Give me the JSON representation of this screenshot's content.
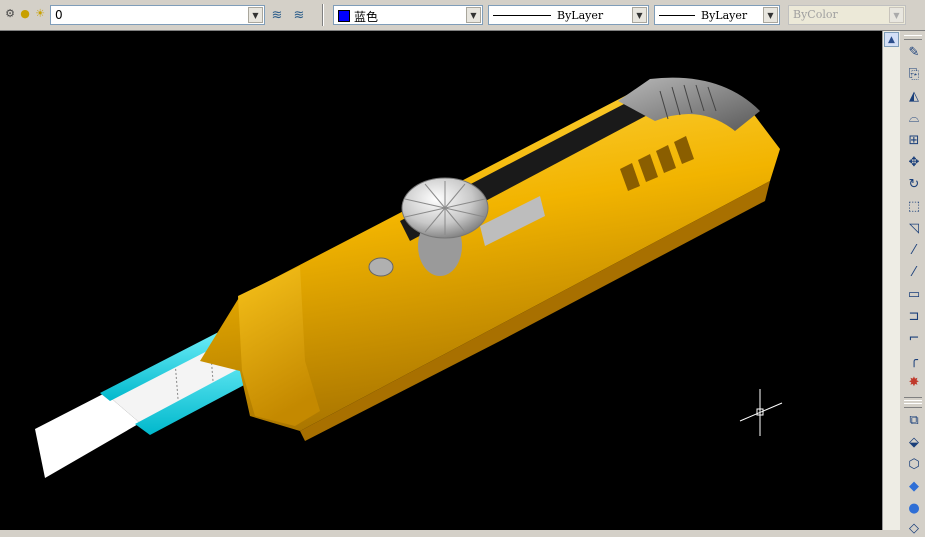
{
  "toolbar": {
    "layer_icons": [
      "layer-state-icon",
      "lightbulb-icon",
      "sun-icon",
      "lock-icon",
      "color-square-icon"
    ],
    "layer_name": "0",
    "color_value": "蓝色",
    "linetype_value": "ByLayer",
    "lineweight_value": "ByLayer",
    "plotstyle_value": "ByColor",
    "colors": {
      "current_color": "#0000ff"
    }
  },
  "drawing": {
    "background": "#000000",
    "body_color": "#f2b400",
    "blade_color": "#ffffff",
    "channel_color": "#00e5ff",
    "cap_color": "#8a8a8a"
  },
  "modify_toolbar": {
    "tools": [
      "erase-icon",
      "copy-icon",
      "mirror-icon",
      "offset-icon",
      "array-icon",
      "move-icon",
      "rotate-icon",
      "scale-icon",
      "stretch-icon",
      "trim-icon",
      "extend-icon",
      "break-icon",
      "join-icon",
      "chamfer-icon",
      "fillet-icon",
      "explode-icon"
    ],
    "solids_tools": [
      "box-section-icon",
      "extrude-icon",
      "box-icon",
      "cube-icon",
      "sphere-icon",
      "layer-face-icon"
    ]
  }
}
